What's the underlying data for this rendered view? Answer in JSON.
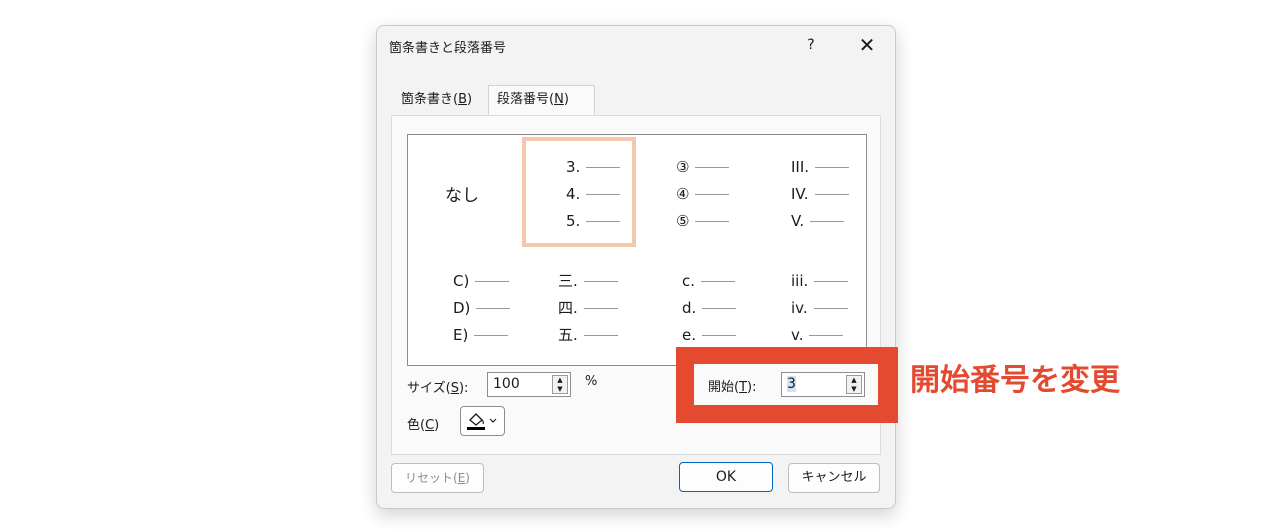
{
  "dialog": {
    "title": "箇条書きと段落番号",
    "help": "?",
    "close": "✕"
  },
  "tabs": [
    {
      "label": "箇条書き(",
      "key": "B",
      "suffix": ")"
    },
    {
      "label": "段落番号(",
      "key": "N",
      "suffix": ")"
    }
  ],
  "gallery": {
    "none": "なし",
    "selected_index": 1,
    "row1": [
      [
        "3.",
        "4.",
        "5."
      ],
      [
        "③",
        "④",
        "⑤"
      ],
      [
        "III.",
        "IV.",
        "V."
      ]
    ],
    "row2": [
      [
        "C)",
        "D)",
        "E)"
      ],
      [
        "三.",
        "四.",
        "五."
      ],
      [
        "c.",
        "d.",
        "e."
      ],
      [
        "iii.",
        "iv.",
        "v."
      ]
    ]
  },
  "size": {
    "label": "サイズ(",
    "key": "S",
    "suffix": "):",
    "value": "100",
    "unit": "%"
  },
  "color": {
    "label": "色(",
    "key": "C",
    "suffix": ")",
    "swatch": "#000000"
  },
  "start": {
    "label": "開始(",
    "key": "T",
    "suffix": "):",
    "value": "3"
  },
  "buttons": {
    "reset": {
      "label": "リセット(",
      "key": "E",
      "suffix": ")"
    },
    "ok": "OK",
    "cancel": "キャンセル"
  },
  "annotation": {
    "text": "開始番号を変更",
    "color": "#e34a30"
  }
}
